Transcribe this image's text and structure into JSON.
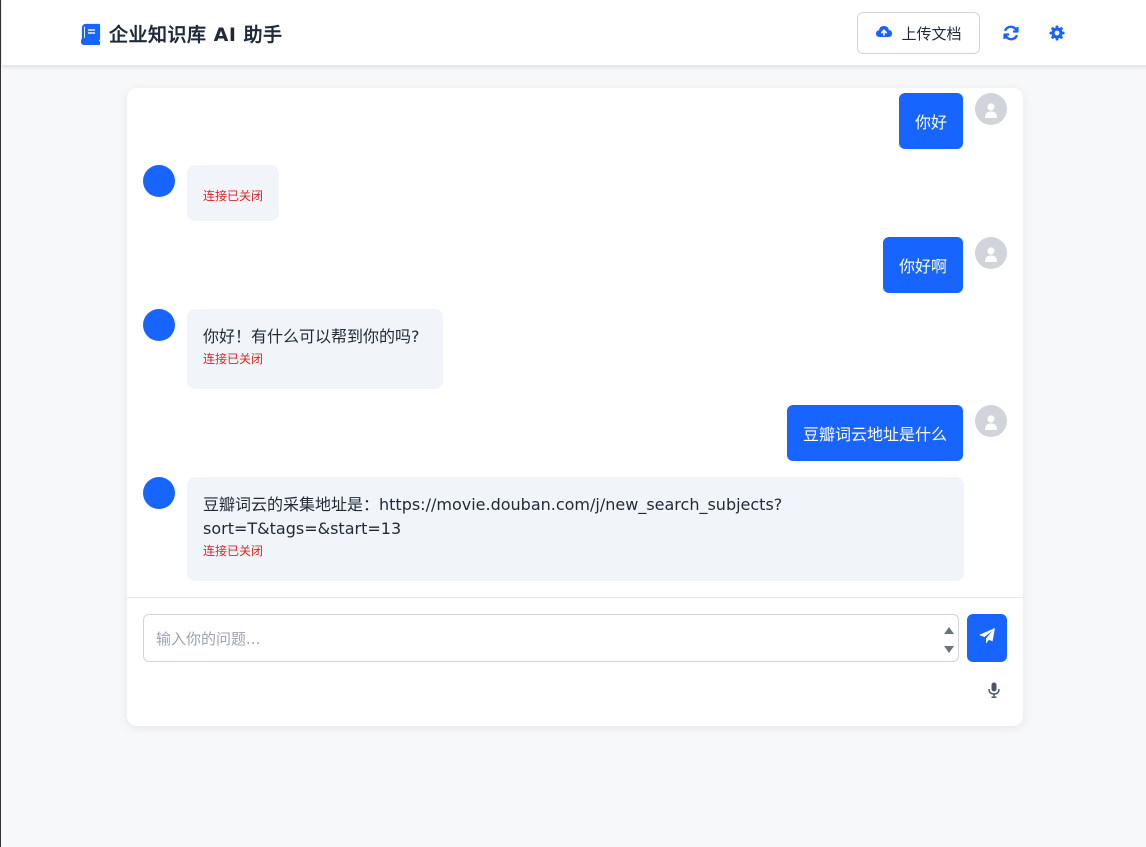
{
  "header": {
    "title": "企业知识库 AI 助手",
    "upload_label": "上传文档",
    "icons": {
      "brand": "book-icon",
      "upload": "cloud-upload-icon",
      "refresh": "refresh-icon",
      "settings": "gear-icon"
    },
    "accent_color": "#1764ff"
  },
  "chat": {
    "messages": [
      {
        "role": "user",
        "text": "你好"
      },
      {
        "role": "assistant",
        "text": "",
        "status": "连接已关闭"
      },
      {
        "role": "user",
        "text": "你好啊"
      },
      {
        "role": "assistant",
        "text": "你好！有什么可以帮到你的吗?",
        "status": "连接已关闭"
      },
      {
        "role": "user",
        "text": "豆瓣词云地址是什么"
      },
      {
        "role": "assistant",
        "text": "豆瓣词云的采集地址是：https://movie.douban.com/j/new_search_subjects?sort=T&tags=&start=13",
        "text_lines": [
          "豆瓣词云的采集地址是：https://movie.douban.com/j/new_search_subjects?",
          "sort=T&tags=&start=13"
        ],
        "status": "连接已关闭"
      }
    ]
  },
  "composer": {
    "placeholder": "输入你的问题...",
    "icons": {
      "send": "send-icon",
      "mic": "microphone-icon"
    }
  }
}
